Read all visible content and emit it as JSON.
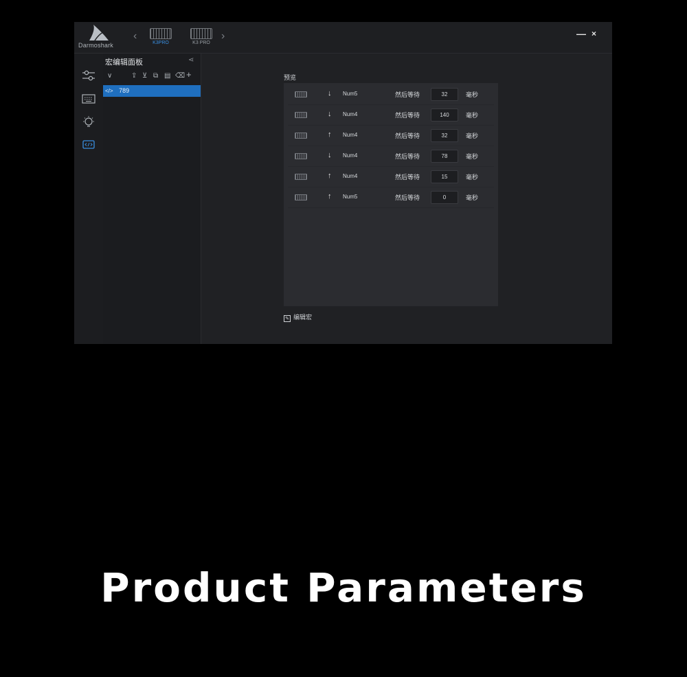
{
  "app": {
    "brand": "Darmoshark",
    "devices": [
      {
        "label": "K3PRO",
        "active": true
      },
      {
        "label": "K3 PRO",
        "active": false
      }
    ],
    "window_controls": {
      "minimize": "—",
      "close": "×"
    }
  },
  "sidebar": {
    "items": [
      {
        "icon": "sliders-icon"
      },
      {
        "icon": "keyboard-icon"
      },
      {
        "icon": "lightbulb-icon"
      },
      {
        "icon": "macro-code-icon",
        "active": true
      }
    ]
  },
  "macro_panel": {
    "title": "宏编辑面板",
    "toolbar": [
      "export-icon",
      "import-icon",
      "copy-icon",
      "paste-icon",
      "delete-icon",
      "add-icon"
    ],
    "items": [
      {
        "code_icon": "</>",
        "name": "789"
      }
    ]
  },
  "preview": {
    "label": "预览",
    "wait_text": "然后等待",
    "unit_text": "毫秒",
    "steps": [
      {
        "direction": "↓",
        "key": "Num5",
        "delay": "32"
      },
      {
        "direction": "↓",
        "key": "Num4",
        "delay": "140"
      },
      {
        "direction": "↑",
        "key": "Num4",
        "delay": "32"
      },
      {
        "direction": "↓",
        "key": "Num4",
        "delay": "78"
      },
      {
        "direction": "↑",
        "key": "Num4",
        "delay": "15"
      },
      {
        "direction": "↑",
        "key": "Num5",
        "delay": "0"
      }
    ],
    "edit_label": "编辑宏"
  },
  "headline": "Product Parameters",
  "colors": {
    "accent": "#1f6fbf",
    "device_active": "#3a8fe0",
    "background": "#000000",
    "app_background": "#202124"
  }
}
